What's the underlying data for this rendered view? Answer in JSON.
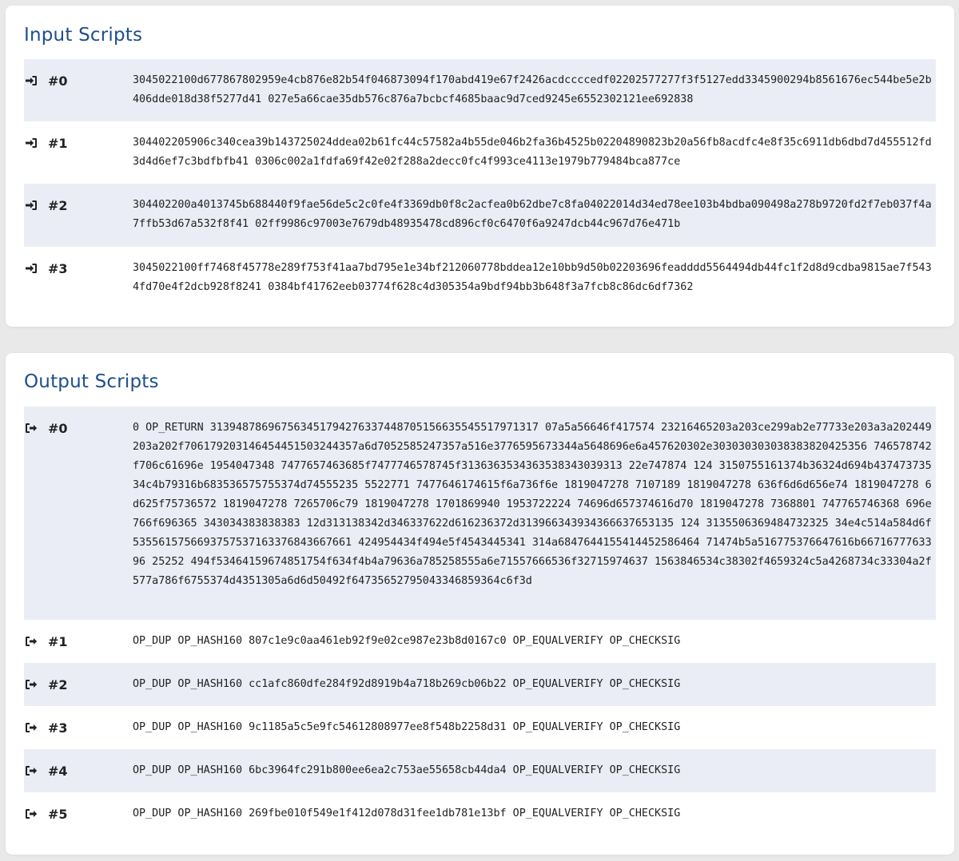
{
  "inputs": {
    "title": "Input Scripts",
    "icon": "sign-in-icon",
    "rows": [
      {
        "index": "#0",
        "script": "3045022100d677867802959e4cb876e82b54f046873094f170abd419e67f2426acdccccedf02202577277f3f5127edd3345900294b8561676ec544be5e2b406dde018d38f5277d41 027e5a66cae35db576c876a7bcbcf4685baac9d7ced9245e6552302121ee692838"
      },
      {
        "index": "#1",
        "script": "304402205906c340cea39b143725024ddea02b61fc44c57582a4b55de046b2fa36b4525b02204890823b20a56fb8acdfc4e8f35c6911db6dbd7d455512fd3d4d6ef7c3bdfbfb41 0306c002a1fdfa69f42e02f288a2decc0fc4f993ce4113e1979b779484bca877ce"
      },
      {
        "index": "#2",
        "script": "304402200a4013745b688440f9fae56de5c2c0fe4f3369db0f8c2acfea0b62dbe7c8fa04022014d34ed78ee103b4bdba090498a278b9720fd2f7eb037f4a7ffb53d67a532f8f41 02ff9986c97003e7679db48935478cd896cf0c6470f6a9247dcb44c967d76e471b"
      },
      {
        "index": "#3",
        "script": "3045022100ff7468f45778e289f753f41aa7bd795e1e34bf212060778bddea12e10bb9d50b02203696feadddd5564494db44fc1f2d8d9cdba9815ae7f5434fd70e4f2dcb928f8241 0384bf41762eeb03774f628c4d305354a9bdf94bb3b648f3a7fcb8c86dc6df7362"
      }
    ]
  },
  "outputs": {
    "title": "Output Scripts",
    "icon": "sign-out-icon",
    "rows": [
      {
        "index": "#0",
        "script": "0 OP_RETURN 313948786967563451794276337448705156635545517971317 07a5a56646f417574 23216465203a203ce299ab2e77733e203a3a202449203a202f706179203146454451503244357a6d7052585247357a516e3776595673344a5648696e6a457620302e303030303038383820425356 746578742f706c61696e 1954047348 7477657463685f7477746578745f3136363534363538343039313 22e747874 124 3150755161374b36324d694b43747373534c4b79316b683536575755374d74555235 5522771 7477646174615f6a736f6e 1819047278 7107189 1819047278 636f6d6d656e74 1819047278 6d625f75736572 1819047278 7265706c79 1819047278 1701869940 1953722224 74696d657374616d70 1819047278 7368801 747765746368 696e766f696365 343034383838383 12d313138342d346337622d616236372d313966343934366637653135 124 3135506369484732325 34e4c514a584d6f5355615756693757537163376843667661 424954434f494e5f4543445341 314a6847644155414452586464 71474b5a516775376647616b6671677763396 25252 494f53464159674851754f634f4b4a79636a785258555a6e71557666536f32715974637 1563846534c38302f4659324c5a4268734c33304a2f577a786f6755374d4351305a6d6d50492f64735652795043346859364c6f3d"
      },
      {
        "index": "#1",
        "script": "OP_DUP OP_HASH160 807c1e9c0aa461eb92f9e02ce987e23b8d0167c0 OP_EQUALVERIFY OP_CHECKSIG"
      },
      {
        "index": "#2",
        "script": "OP_DUP OP_HASH160 cc1afc860dfe284f92d8919b4a718b269cb06b22 OP_EQUALVERIFY OP_CHECKSIG"
      },
      {
        "index": "#3",
        "script": "OP_DUP OP_HASH160 9c1185a5c5e9fc54612808977ee8f548b2258d31 OP_EQUALVERIFY OP_CHECKSIG"
      },
      {
        "index": "#4",
        "script": "OP_DUP OP_HASH160 6bc3964fc291b800ee6ea2c753ae55658cb44da4 OP_EQUALVERIFY OP_CHECKSIG"
      },
      {
        "index": "#5",
        "script": "OP_DUP OP_HASH160 269fbe010f549e1f412d078d31fee1db781e13bf OP_EQUALVERIFY OP_CHECKSIG"
      }
    ]
  }
}
